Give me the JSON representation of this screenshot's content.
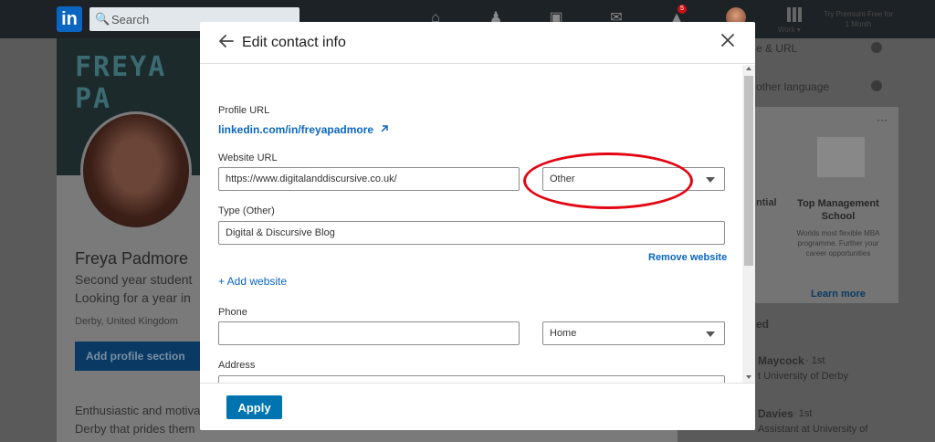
{
  "nav": {
    "logo": "in",
    "search_placeholder": "Search",
    "work_label": "Work ▾",
    "premium_text": "Try Premium Free for 1 Month",
    "notification_count": "5"
  },
  "background_profile": {
    "banner_text": "FREYA PA",
    "name": "Freya Padmore",
    "headline_1": "Second year student",
    "headline_2": "Looking for a year in",
    "location": "Derby, United Kingdom",
    "add_section": "Add profile section",
    "about_1": "Enthusiastic and motiva",
    "about_2": "Derby that prides them"
  },
  "right_column": {
    "item1": "e & URL",
    "item2": "other language",
    "ad_heading": "Top Management School",
    "ad_sub": "Worlds most flexible MBA programme. Further your career opportunities",
    "ad_left": "ntial",
    "ad_learn": "Learn more",
    "section": "ed",
    "person1_name": "Maycock",
    "person1_degree": "· 1st",
    "person1_role": "t University of Derby",
    "person2_name": "Davies",
    "person2_degree": "· 1st",
    "person2_role": "Assistant at University of"
  },
  "modal": {
    "title": "Edit contact info",
    "profile_url_label": "Profile URL",
    "profile_url": "linkedin.com/in/freyapadmore",
    "website_url_label": "Website URL",
    "website_url_value": "https://www.digitalanddiscursive.co.uk/",
    "website_type": "Other",
    "type_other_label": "Type (Other)",
    "type_other_value": "Digital & Discursive Blog",
    "remove_website": "Remove website",
    "add_website": "+ Add website",
    "phone_label": "Phone",
    "phone_value": "",
    "phone_type": "Home",
    "address_label": "Address",
    "address_value": "",
    "apply": "Apply"
  },
  "colors": {
    "brand_blue": "#0a66c2",
    "apply_blue": "#0073b1",
    "highlight_red": "#e30613"
  }
}
